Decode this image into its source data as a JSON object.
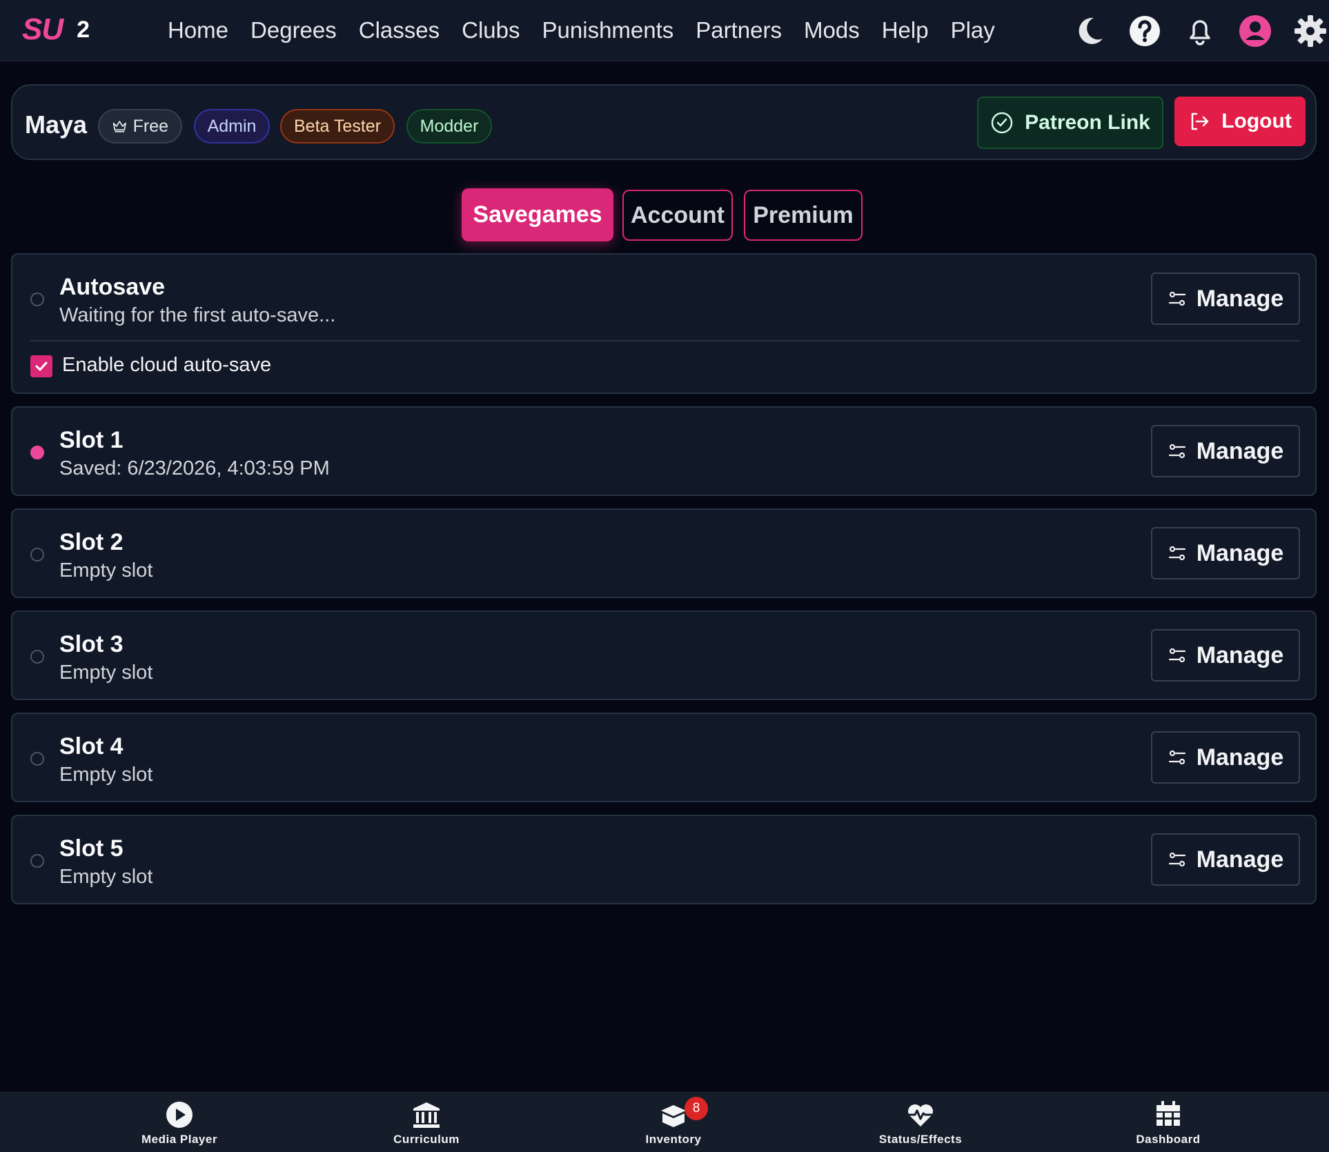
{
  "app": {
    "logo": "SU",
    "version": "2"
  },
  "nav": {
    "links": [
      "Home",
      "Degrees",
      "Classes",
      "Clubs",
      "Punishments",
      "Partners",
      "Mods",
      "Help",
      "Play"
    ]
  },
  "top_icons": [
    "moon-icon",
    "help-icon",
    "bell-icon",
    "user-icon",
    "gear-icon"
  ],
  "profile": {
    "name": "Maya",
    "badges": {
      "free": "Free",
      "admin": "Admin",
      "beta": "Beta Tester",
      "modder": "Modder"
    },
    "patreon_label": "Patreon Link",
    "logout_label": "Logout"
  },
  "tabs": {
    "savegames": "Savegames",
    "account": "Account",
    "premium": "Premium",
    "active": "Savegames"
  },
  "autosave": {
    "title": "Autosave",
    "status": "Waiting for the first auto-save...",
    "manage_label": "Manage",
    "cloud_label": "Enable cloud auto-save",
    "cloud_enabled": true
  },
  "slots": [
    {
      "title": "Slot 1",
      "status": "Saved: 6/23/2026, 4:03:59 PM",
      "selected": true,
      "manage_label": "Manage"
    },
    {
      "title": "Slot 2",
      "status": "Empty slot",
      "selected": false,
      "manage_label": "Manage"
    },
    {
      "title": "Slot 3",
      "status": "Empty slot",
      "selected": false,
      "manage_label": "Manage"
    },
    {
      "title": "Slot 4",
      "status": "Empty slot",
      "selected": false,
      "manage_label": "Manage"
    },
    {
      "title": "Slot 5",
      "status": "Empty slot",
      "selected": false,
      "manage_label": "Manage"
    }
  ],
  "bottom_nav": {
    "media_player": "Media Player",
    "curriculum": "Curriculum",
    "inventory": "Inventory",
    "inventory_count": "8",
    "status_effects": "Status/Effects",
    "dashboard": "Dashboard"
  },
  "colors": {
    "accent": "#db2777",
    "logout": "#e11d48",
    "background": "#050814",
    "card": "#111827"
  }
}
